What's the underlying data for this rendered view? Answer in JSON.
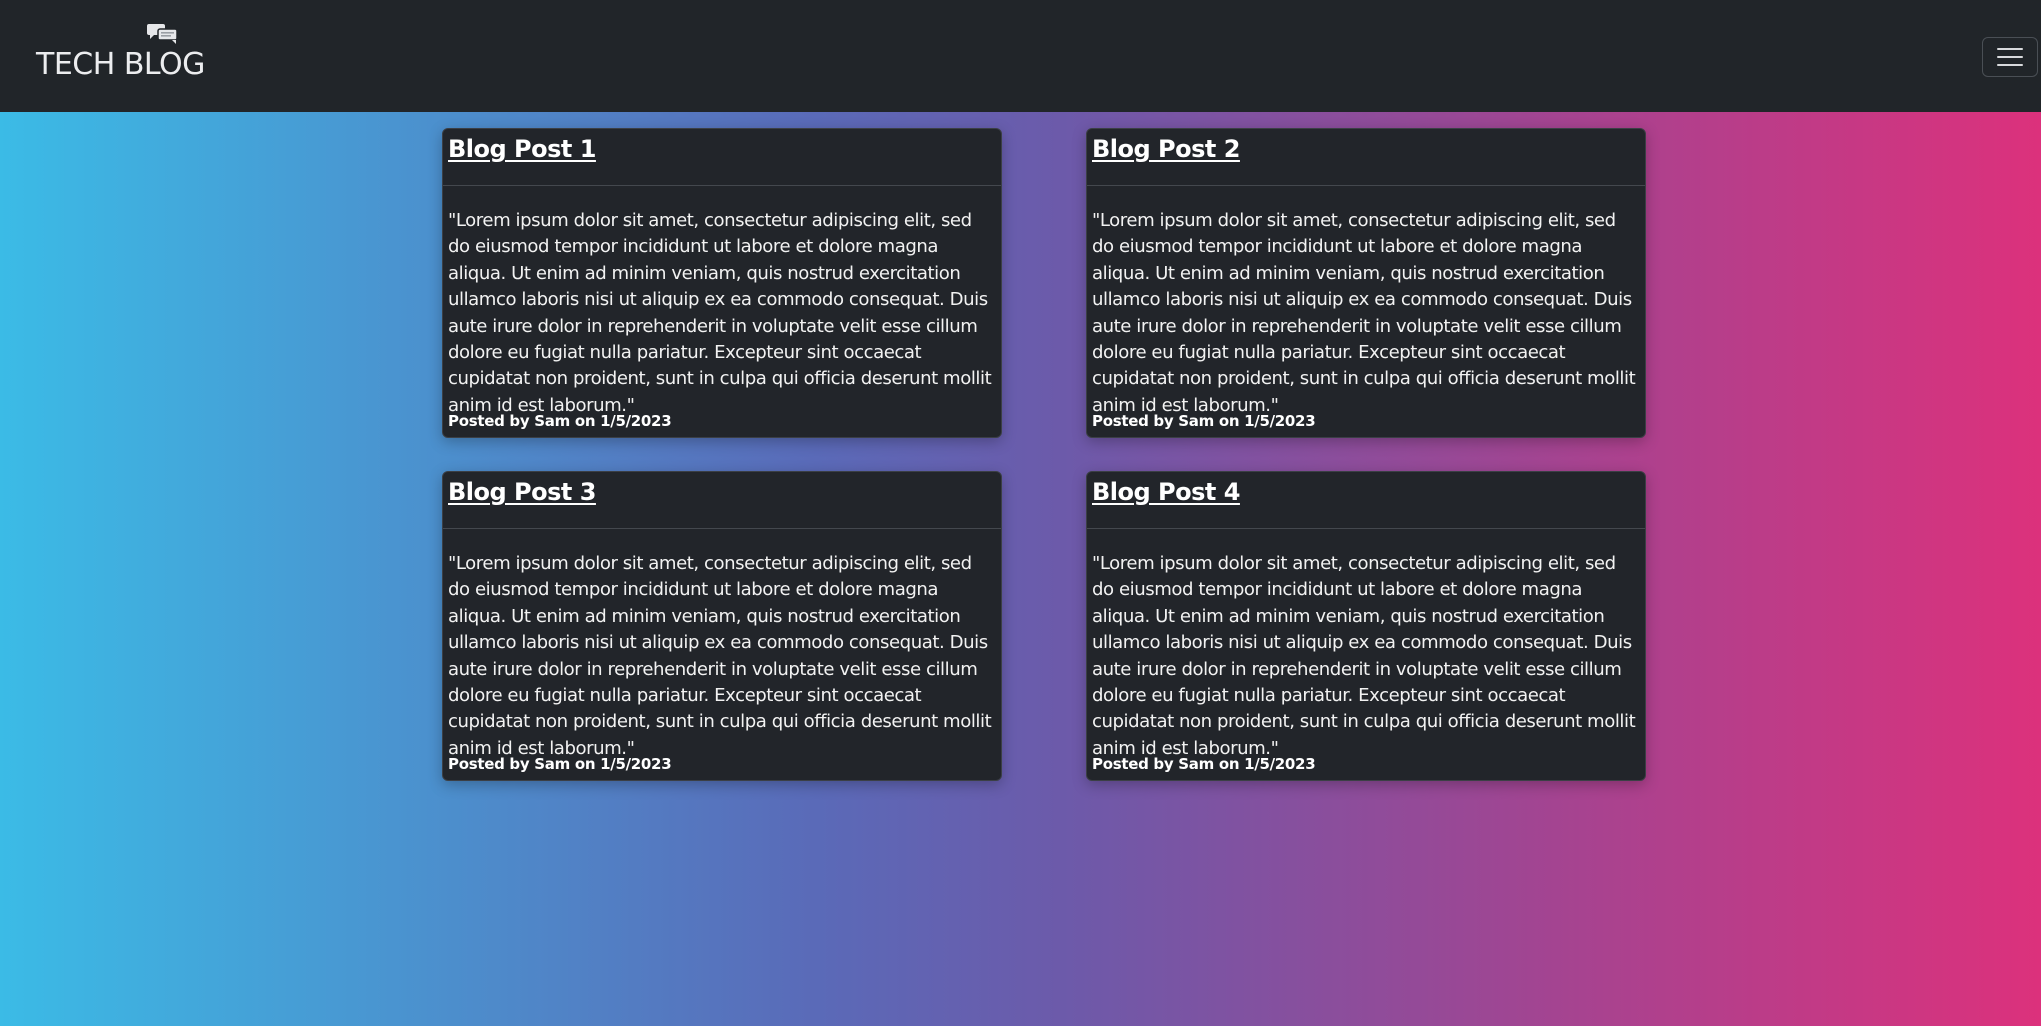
{
  "navbar": {
    "brand": "TECH BLOG",
    "brand_icon": "chat-bubbles-icon",
    "menu_icon": "hamburger-menu-icon"
  },
  "posts": [
    {
      "title": "Blog Post 1",
      "body": "\"Lorem ipsum dolor sit amet, consectetur adipiscing elit, sed do eiusmod tempor incididunt ut labore et dolore magna aliqua. Ut enim ad minim veniam, quis nostrud exercitation ullamco laboris nisi ut aliquip ex ea commodo consequat. Duis aute irure dolor in reprehenderit in voluptate velit esse cillum dolore eu fugiat nulla pariatur. Excepteur sint occaecat cupidatat non proident, sunt in culpa qui officia deserunt mollit anim id est laborum.\"",
      "footer": "Posted by Sam on 1/5/2023"
    },
    {
      "title": "Blog Post 2",
      "body": "\"Lorem ipsum dolor sit amet, consectetur adipiscing elit, sed do eiusmod tempor incididunt ut labore et dolore magna aliqua. Ut enim ad minim veniam, quis nostrud exercitation ullamco laboris nisi ut aliquip ex ea commodo consequat. Duis aute irure dolor in reprehenderit in voluptate velit esse cillum dolore eu fugiat nulla pariatur. Excepteur sint occaecat cupidatat non proident, sunt in culpa qui officia deserunt mollit anim id est laborum.\"",
      "footer": "Posted by Sam on 1/5/2023"
    },
    {
      "title": "Blog Post 3",
      "body": "\"Lorem ipsum dolor sit amet, consectetur adipiscing elit, sed do eiusmod tempor incididunt ut labore et dolore magna aliqua. Ut enim ad minim veniam, quis nostrud exercitation ullamco laboris nisi ut aliquip ex ea commodo consequat. Duis aute irure dolor in reprehenderit in voluptate velit esse cillum dolore eu fugiat nulla pariatur. Excepteur sint occaecat cupidatat non proident, sunt in culpa qui officia deserunt mollit anim id est laborum.\"",
      "footer": "Posted by Sam on 1/5/2023"
    },
    {
      "title": "Blog Post 4",
      "body": "\"Lorem ipsum dolor sit amet, consectetur adipiscing elit, sed do eiusmod tempor incididunt ut labore et dolore magna aliqua. Ut enim ad minim veniam, quis nostrud exercitation ullamco laboris nisi ut aliquip ex ea commodo consequat. Duis aute irure dolor in reprehenderit in voluptate velit esse cillum dolore eu fugiat nulla pariatur. Excepteur sint occaecat cupidatat non proident, sunt in culpa qui officia deserunt mollit anim id est laborum.\"",
      "footer": "Posted by Sam on 1/5/2023"
    }
  ],
  "colors": {
    "navbar_bg": "#212529",
    "card_bg": "#22252a",
    "gradient_start": "#3bbbe6",
    "gradient_mid": "#6c5aaa",
    "gradient_end": "#dc317c"
  }
}
